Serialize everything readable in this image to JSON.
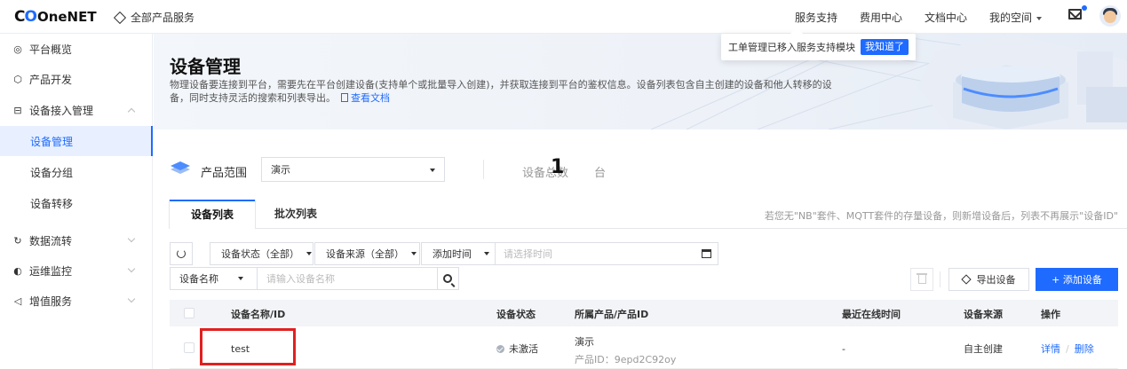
{
  "topbar": {
    "logo_mark": "C",
    "logo_mark2": "O",
    "logo_text": "OneNET",
    "all_products": "全部产品服务",
    "nav": [
      "服务支持",
      "费用中心",
      "文档中心",
      "我的空间"
    ]
  },
  "sidebar": {
    "items": [
      {
        "label": "平台概览",
        "icon": "dashboard-icon"
      },
      {
        "label": "产品开发",
        "icon": "product-icon"
      },
      {
        "label": "设备接入管理",
        "icon": "device-access-icon"
      },
      {
        "label": "设备管理"
      },
      {
        "label": "设备分组"
      },
      {
        "label": "设备转移"
      },
      {
        "label": "数据流转",
        "icon": "dataflow-icon"
      },
      {
        "label": "运维监控",
        "icon": "monitor-icon"
      },
      {
        "label": "增值服务",
        "icon": "value-added-icon"
      }
    ]
  },
  "banner": {
    "title": "设备管理",
    "desc": "物理设备要连接到平台，需要先在平台创建设备(支持单个或批量导入创建)，并获取连接到平台的鉴权信息。设备列表包含自主创建的设备和他人转移的设备，同时支持灵活的搜索和列表导出。",
    "doc_link": "查看文档"
  },
  "notice": {
    "text": "工单管理已移入服务支持模块",
    "button": "我知道了"
  },
  "range": {
    "label": "产品范围",
    "selected": "演示",
    "total_label": "设备总数",
    "total_value": "1",
    "total_unit": "台"
  },
  "tabs": [
    {
      "label": "设备列表",
      "active": true
    },
    {
      "label": "批次列表",
      "active": false
    }
  ],
  "tab_hint": "若您无\"NB\"套件、MQTT套件的存量设备，则新增设备后，列表不再展示\"设备ID\"",
  "filters": {
    "status": "设备状态（全部）",
    "source": "设备来源（全部）",
    "time_type": "添加时间",
    "time_placeholder": "请选择时间",
    "name_type": "设备名称",
    "name_placeholder": "请输入设备名称"
  },
  "actions": {
    "export": "导出设备",
    "add": "+ 添加设备"
  },
  "table": {
    "headers": [
      "设备名称/ID",
      "设备状态",
      "所属产品/产品ID",
      "最近在线时间",
      "设备来源",
      "操作"
    ],
    "rows": [
      {
        "name": "test",
        "status": "未激活",
        "product": "演示",
        "product_id": "产品ID：9epd2C92oy",
        "last_online": "-",
        "source": "自主创建",
        "op_detail": "详情",
        "op_sep": "/",
        "op_delete": "删除"
      }
    ]
  },
  "colors": {
    "accent": "#1f6bff",
    "highlight": "#e02020"
  }
}
